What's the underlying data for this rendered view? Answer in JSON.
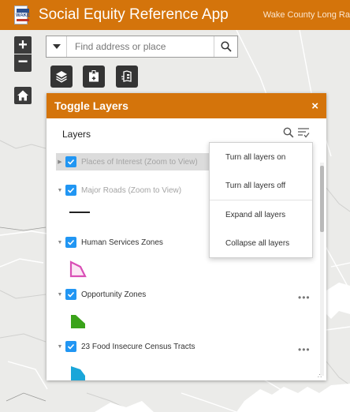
{
  "header": {
    "title": "Social Equity Reference App",
    "subtitle": "Wake County Long Ra",
    "logo_text": "WAKE"
  },
  "map": {
    "zoom_in": "+",
    "zoom_out": "−",
    "icons": [
      "plus-icon",
      "minus-icon",
      "home-icon"
    ]
  },
  "search": {
    "placeholder": "Find address or place"
  },
  "toolbar": {
    "icons": [
      "layers-icon",
      "bookmark-add-icon",
      "legend-icon"
    ]
  },
  "panel": {
    "title": "Toggle Layers",
    "close": "×",
    "layers_label": "Layers",
    "layers": [
      {
        "label": "Places of Interest (Zoom to View)",
        "checked": true,
        "visible_at_scale": false,
        "expanded": false
      },
      {
        "label": "Major Roads (Zoom to View)",
        "checked": true,
        "visible_at_scale": false,
        "expanded": true
      },
      {
        "label": "Human Services Zones",
        "checked": true,
        "visible_at_scale": true,
        "expanded": true
      },
      {
        "label": "Opportunity Zones",
        "checked": true,
        "visible_at_scale": true,
        "expanded": true
      },
      {
        "label": "23 Food Insecure Census Tracts",
        "checked": true,
        "visible_at_scale": true,
        "expanded": true
      }
    ],
    "more": "•••"
  },
  "menu": {
    "items": [
      "Turn all layers on",
      "Turn all layers off",
      "Expand all layers",
      "Collapse all layers"
    ]
  },
  "colors": {
    "brand": "#d4740b",
    "checkbox": "#2196f3",
    "human_services": "#d94fb6",
    "opportunity": "#3aa31a",
    "food_insecure": "#1aa6d9"
  }
}
